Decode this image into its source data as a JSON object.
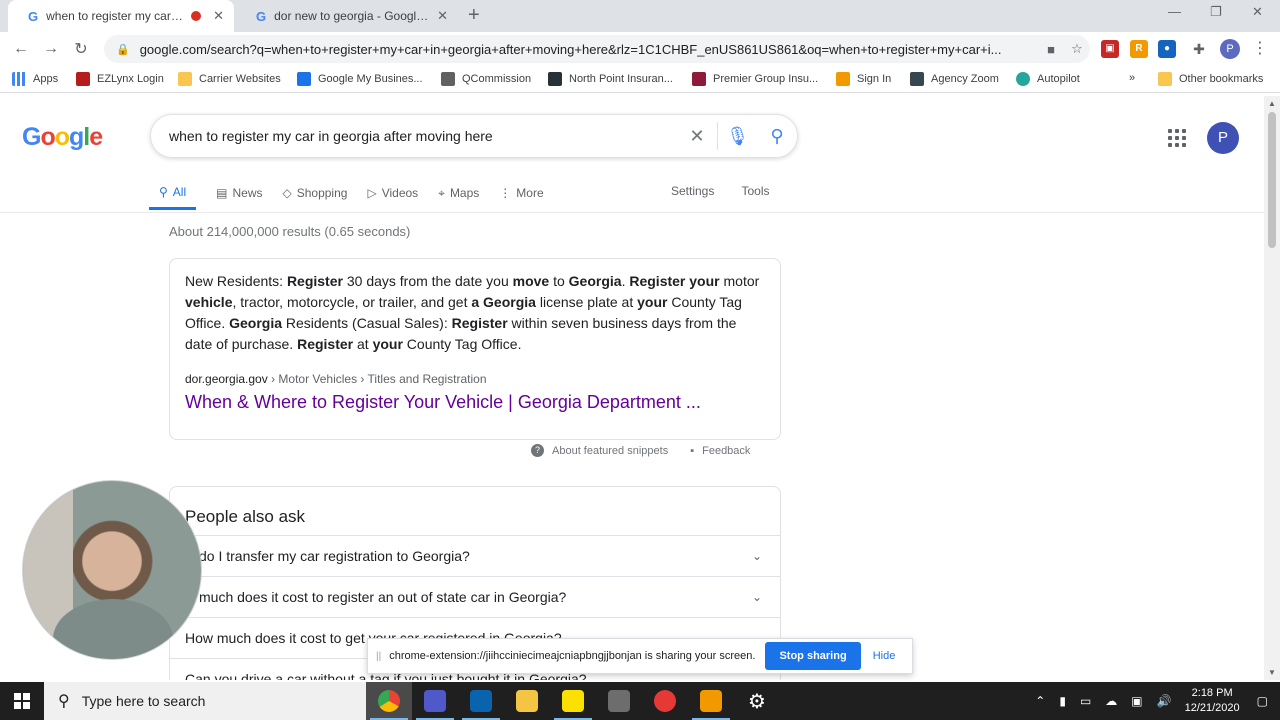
{
  "browser": {
    "tabs": [
      {
        "title": "when to register my car in georgia after moving here - Google Search",
        "active": true,
        "recording": true
      },
      {
        "title": "dor new to georgia - Google Search",
        "active": false
      }
    ],
    "url": "google.com/search?q=when+to+register+my+car+in+georgia+after+moving+here&rlz=1C1CHBF_enUS861US861&oq=when+to+register+my+car+i...",
    "profile_initial": "P",
    "bookmarks": [
      "Apps",
      "EZLynx Login",
      "Carrier Websites",
      "Google My Busines...",
      "QCommission",
      "North Point Insuran...",
      "Premier Group Insu...",
      "Sign In",
      "Agency Zoom",
      "Autopilot"
    ],
    "bookmarks_overflow": "»",
    "other_bookmarks": "Other bookmarks"
  },
  "search": {
    "logo": "Google",
    "query": "when to register my car in georgia after moving here",
    "tabs": [
      "All",
      "News",
      "Shopping",
      "Videos",
      "Maps",
      "More"
    ],
    "settings": "Settings",
    "tools": "Tools",
    "results_count": "About 214,000,000 results (0.65 seconds)",
    "avatar_initial": "P"
  },
  "snippet": {
    "text_html": "New Residents: <b>Register</b> 30 days from the date you <b>move</b> to <b>Georgia</b>. <b>Register your</b> motor <b>vehicle</b>, tractor, motorcycle, or trailer, and get <b>a Georgia</b> license plate at <b>your</b> County Tag Office. <b>Georgia</b> Residents (Casual Sales): <b>Register</b> within seven business days from the date of purchase. <b>Register</b> at <b>your</b> County Tag Office.",
    "domain": "dor.georgia.gov",
    "breadcrumb": " › Motor Vehicles › Titles and Registration",
    "link": "When & Where to Register Your Vehicle | Georgia Department ...",
    "about": "About featured snippets",
    "feedback": "Feedback"
  },
  "people_also_ask": {
    "heading": "People also ask",
    "questions": [
      "w do I transfer my car registration to Georgia?",
      "w much does it cost to register an out of state car in Georgia?",
      "How much does it cost to get your car registered in Georgia?",
      "Can you drive a car without a tag if you just bought it in Georgia?"
    ]
  },
  "share_bar": {
    "message": "chrome-extension://jiihcciniecimeajcniapbngjjbonjan is sharing your screen.",
    "stop": "Stop sharing",
    "hide": "Hide"
  },
  "taskbar": {
    "search_placeholder": "Type here to search",
    "time": "2:18 PM",
    "date": "12/21/2020"
  }
}
